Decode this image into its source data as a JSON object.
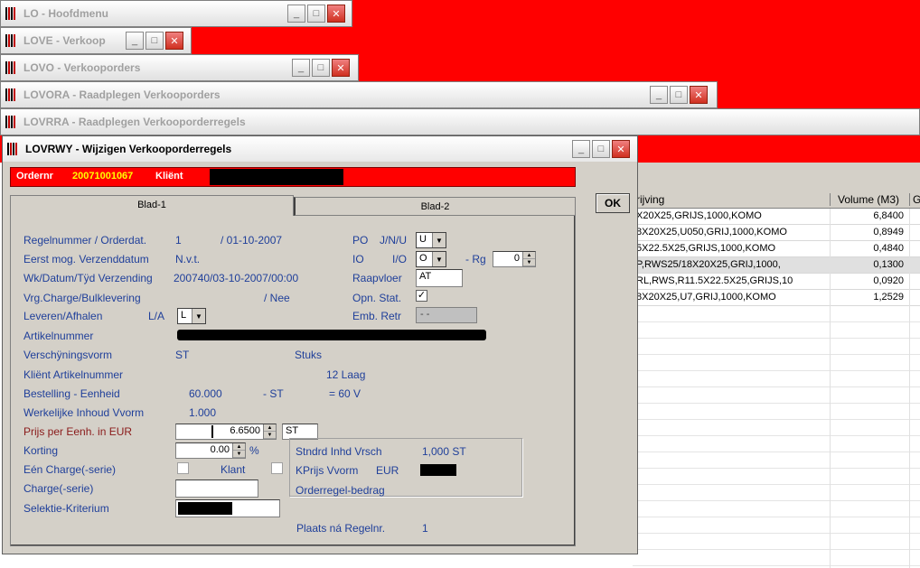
{
  "windows": {
    "lo": {
      "title": "LO - Hoofdmenu"
    },
    "love": {
      "title": "LOVE - Verkoop"
    },
    "lovo": {
      "title": "LOVO - Verkooporders"
    },
    "lovora": {
      "title": "LOVORA - Raadplegen Verkooporders"
    },
    "lovrra": {
      "title": "LOVRRA - Raadplegen Verkooporderregels"
    }
  },
  "grid": {
    "headers": [
      "rijving",
      "Volume (M3)",
      "G"
    ],
    "rows": [
      {
        "desc": "X20X25,GRIJS,1000,KOMO",
        "vol": "6,8400"
      },
      {
        "desc": "8X20X25,U050,GRIJ,1000,KOMO",
        "vol": "0,8949"
      },
      {
        "desc": "5X22.5X25,GRIJS,1000,KOMO",
        "vol": "0,4840"
      },
      {
        "desc": "P,RWS25/18X20X25,GRIJ,1000,",
        "vol": "0,1300"
      },
      {
        "desc": "RL,RWS,R11.5X22.5X25,GRIJS,10",
        "vol": "0,0920"
      },
      {
        "desc": "8X20X25,U7,GRIJ,1000,KOMO",
        "vol": "1,2529"
      }
    ]
  },
  "dialog": {
    "title": "LOVRWY - Wijzigen Verkooporderregels",
    "header": {
      "ordernr_label": "Ordernr",
      "ordernr": "20071001067",
      "klient_label": "Kliënt"
    },
    "tabs": [
      "Blad-1",
      "Blad-2"
    ],
    "ok": "OK",
    "labels": {
      "regelnummer": "Regelnummer / Orderdat.",
      "eerst": "Eerst mog. Verzenddatum",
      "wk": "Wk/Datum/Tÿd Verzending",
      "vrg": "Vrg.Charge/Bulklevering",
      "leveren": "Leveren/Afhalen",
      "la": "L/A",
      "artikel": "Artikelnummer",
      "verschijning": "Verschÿningsvorm",
      "klientart": "Kliënt Artikelnummer",
      "bestelling": "Bestelling - Eenheid",
      "werkelijke": "Werkelijke Inhoud Vvorm",
      "prijs": "Prijs per Eenh. in EUR",
      "korting": "Korting",
      "een_charge": "Eén Charge(-serie)",
      "klant": "Klant",
      "charge": "Charge(-serie)",
      "selektie": "Selektie-Kriterium",
      "po": "PO",
      "jnu": "J/N/U",
      "io": "IO",
      "io2": "I/O",
      "rg": "- Rg",
      "raapvloer": "Raapvloer",
      "opn": "Opn. Stat.",
      "emb": "Emb. Retr",
      "stndrd": "Stndrd Inhd Vrsch",
      "kprijs": "KPrijs Vvorm",
      "eur": "EUR",
      "orderregel": "Orderregel-bedrag",
      "plaats": "Plaats ná Regelnr."
    },
    "values": {
      "regel": "1",
      "datum": "/ 01-10-2007",
      "eerst": "N.v.t.",
      "wk": "200740/03-10-2007/00:00",
      "nee": "/ Nee",
      "la": "L",
      "vorm": "ST",
      "stuks": "Stuks",
      "laag": "12 Laag",
      "bestelling": "60.000",
      "st": "- ST",
      "eq": "= 60 V",
      "werkelijke": "1.000",
      "prijs": "6.6500",
      "prijs_unit": "ST",
      "korting": "0.00",
      "pct": "%",
      "po": "U",
      "io": "O",
      "rg": "0",
      "raapvloer": "AT",
      "opn": "✓",
      "emb": "- -",
      "stndrd": "1,000 ST",
      "plaats": "1"
    }
  }
}
